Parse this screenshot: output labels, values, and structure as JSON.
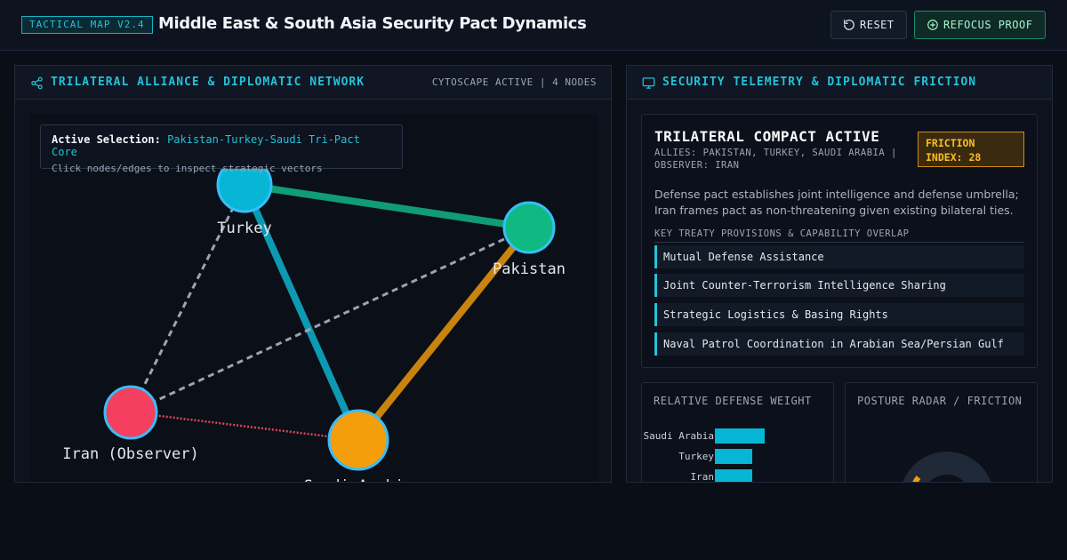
{
  "header": {
    "badge": "TACTICAL MAP V2.4",
    "title": "Middle East & South Asia Security Pact Dynamics",
    "reset_label": "RESET",
    "refocus_label": "REFOCUS PROOF"
  },
  "network_panel": {
    "title": "TRILATERAL ALLIANCE & DIPLOMATIC NETWORK",
    "meta": "CYTOSCAPE ACTIVE | 4 NODES",
    "selection_label": "Active Selection:",
    "selection_value": "Pakistan-Turkey-Saudi Tri-Pact Core",
    "selection_hint": "Click nodes/edges to inspect strategic vectors",
    "nodes": [
      {
        "id": "turkey",
        "label": "Turkey",
        "color": "#06b6d4"
      },
      {
        "id": "pakistan",
        "label": "Pakistan",
        "color": "#10b981"
      },
      {
        "id": "iran",
        "label": "Iran (Observer)",
        "color": "#f43f5e"
      },
      {
        "id": "saudi",
        "label": "Saudi Arabia",
        "color": "#f59e0b"
      }
    ],
    "edges": [
      {
        "source": "turkey",
        "target": "pakistan",
        "color": "#109c74",
        "style": "solid"
      },
      {
        "source": "turkey",
        "target": "saudi",
        "color": "#0e99b3",
        "style": "solid"
      },
      {
        "source": "pakistan",
        "target": "saudi",
        "color": "#c9830f",
        "style": "solid"
      },
      {
        "source": "iran",
        "target": "turkey",
        "color": "#9ca3af",
        "style": "dashed"
      },
      {
        "source": "iran",
        "target": "pakistan",
        "color": "#9ca3af",
        "style": "dashed"
      },
      {
        "source": "iran",
        "target": "saudi",
        "color": "#e0445e",
        "style": "dotted"
      }
    ]
  },
  "telemetry_panel": {
    "title": "SECURITY TELEMETRY & DIPLOMATIC FRICTION",
    "compact_title": "TRILATERAL COMPACT ACTIVE",
    "allies": "ALLIES: PAKISTAN, TURKEY, SAUDI ARABIA | OBSERVER: IRAN",
    "friction_label": "FRICTION INDEX: 28",
    "description": "Defense pact establishes joint intelligence and defense umbrella; Iran frames pact as non-threatening given existing bilateral ties.",
    "provisions_label": "KEY TREATY PROVISIONS & CAPABILITY OVERLAP",
    "provisions": [
      "Mutual Defense Assistance",
      "Joint Counter-Terrorism Intelligence Sharing",
      "Strategic Logistics & Basing Rights",
      "Naval Patrol Coordination in Arabian Sea/Persian Gulf"
    ],
    "defense_weight_title": "RELATIVE DEFENSE WEIGHT",
    "radar_title": "POSTURE RADAR / FRICTION"
  },
  "chart_data": {
    "type": "bar",
    "orientation": "horizontal",
    "title": "RELATIVE DEFENSE WEIGHT",
    "categories": [
      "Saudi Arabia",
      "Turkey",
      "Iran"
    ],
    "values": [
      0.56,
      0.42,
      0.42
    ],
    "color": "#06b6d4"
  }
}
